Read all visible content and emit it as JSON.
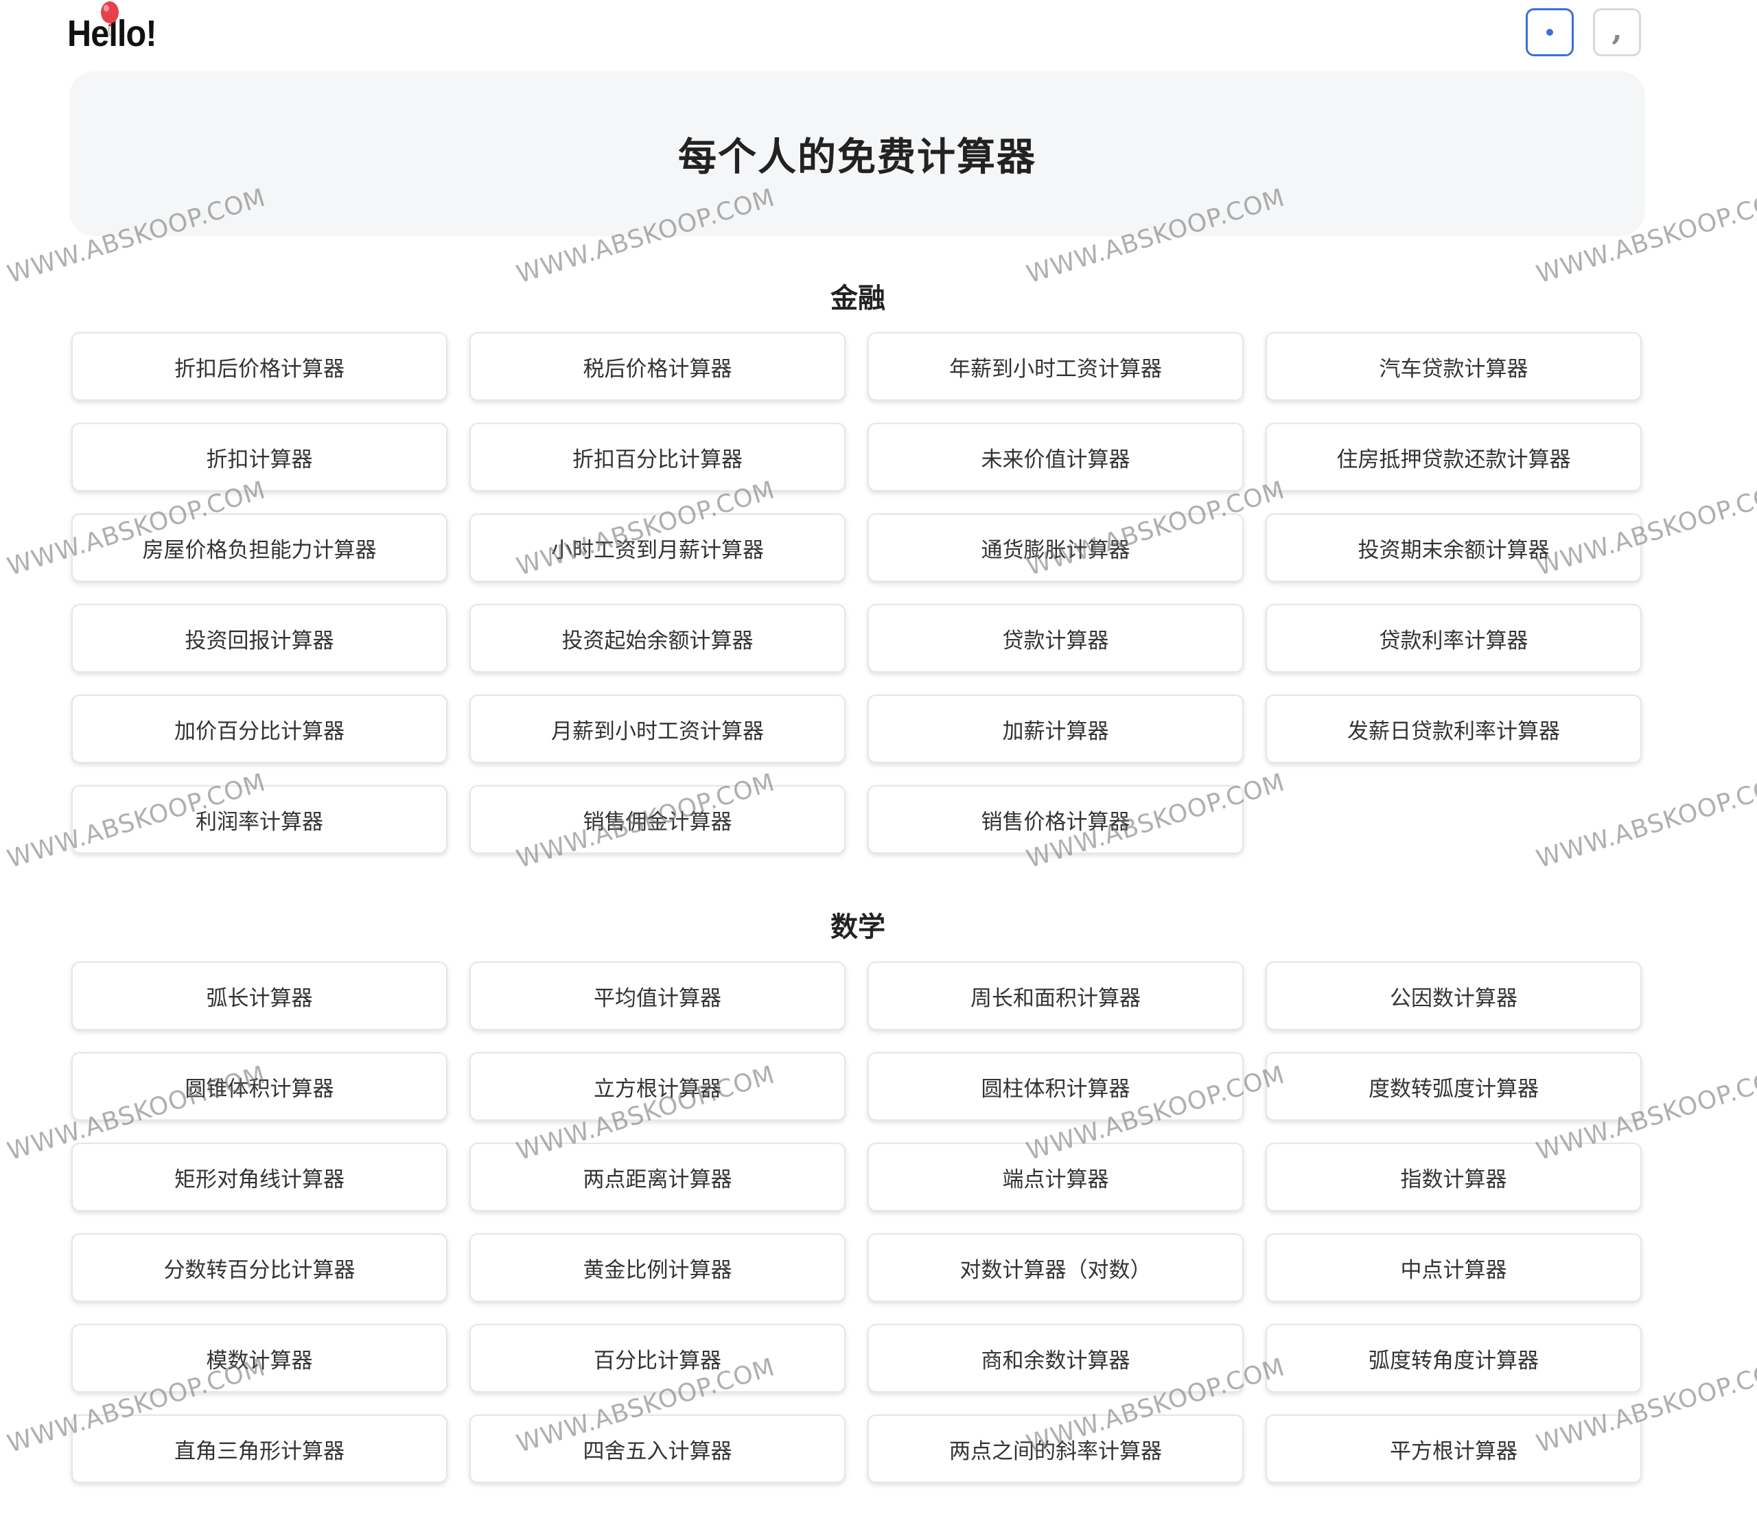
{
  "header": {
    "logo_text": "Hello!",
    "button_dot_icon": "dot-icon",
    "button_comma_icon": "comma-icon",
    "comma_glyph": ","
  },
  "hero": {
    "title": "每个人的免费计算器"
  },
  "finance": {
    "title": "金融",
    "items": [
      "折扣后价格计算器",
      "税后价格计算器",
      "年薪到小时工资计算器",
      "汽车贷款计算器",
      "折扣计算器",
      "折扣百分比计算器",
      "未来价值计算器",
      "住房抵押贷款还款计算器",
      "房屋价格负担能力计算器",
      "小时工资到月薪计算器",
      "通货膨胀计算器",
      "投资期末余额计算器",
      "投资回报计算器",
      "投资起始余额计算器",
      "贷款计算器",
      "贷款利率计算器",
      "加价百分比计算器",
      "月薪到小时工资计算器",
      "加薪计算器",
      "发薪日贷款利率计算器",
      "利润率计算器",
      "销售佣金计算器",
      "销售价格计算器"
    ]
  },
  "math": {
    "title": "数学",
    "items": [
      "弧长计算器",
      "平均值计算器",
      "周长和面积计算器",
      "公因数计算器",
      "圆锥体积计算器",
      "立方根计算器",
      "圆柱体积计算器",
      "度数转弧度计算器",
      "矩形对角线计算器",
      "两点距离计算器",
      "端点计算器",
      "指数计算器",
      "分数转百分比计算器",
      "黄金比例计算器",
      "对数计算器（对数）",
      "中点计算器",
      "模数计算器",
      "百分比计算器",
      "商和余数计算器",
      "弧度转角度计算器",
      "直角三角形计算器",
      "四舍五入计算器",
      "两点之间的斜率计算器",
      "平方根计算器"
    ]
  },
  "watermark": {
    "text": "WWW.ABSKOOP.COM"
  },
  "colors": {
    "accent": "#3c6fd8",
    "hero_bg": "#f5f6f7",
    "balloon": "#e8404a"
  }
}
